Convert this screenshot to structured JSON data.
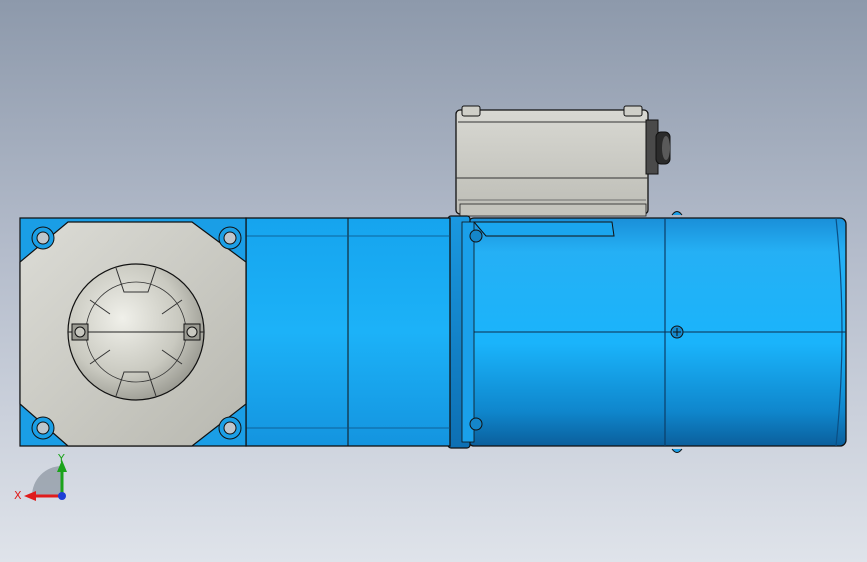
{
  "viewport": {
    "background_top": "#8d99ab",
    "background_bottom": "#dfe3ea"
  },
  "model": {
    "body_color": "#1fa3e6",
    "body_highlight": "#3fc0ff",
    "flange_color": "#c8c8c0",
    "terminal_box_color": "#c9c9c3",
    "outline_color": "#0a0a12"
  },
  "triad": {
    "x_label": "X",
    "y_label": "Y",
    "x_color": "#e01c1c",
    "y_color": "#1ba31b",
    "z_color": "#1d3fd6"
  }
}
